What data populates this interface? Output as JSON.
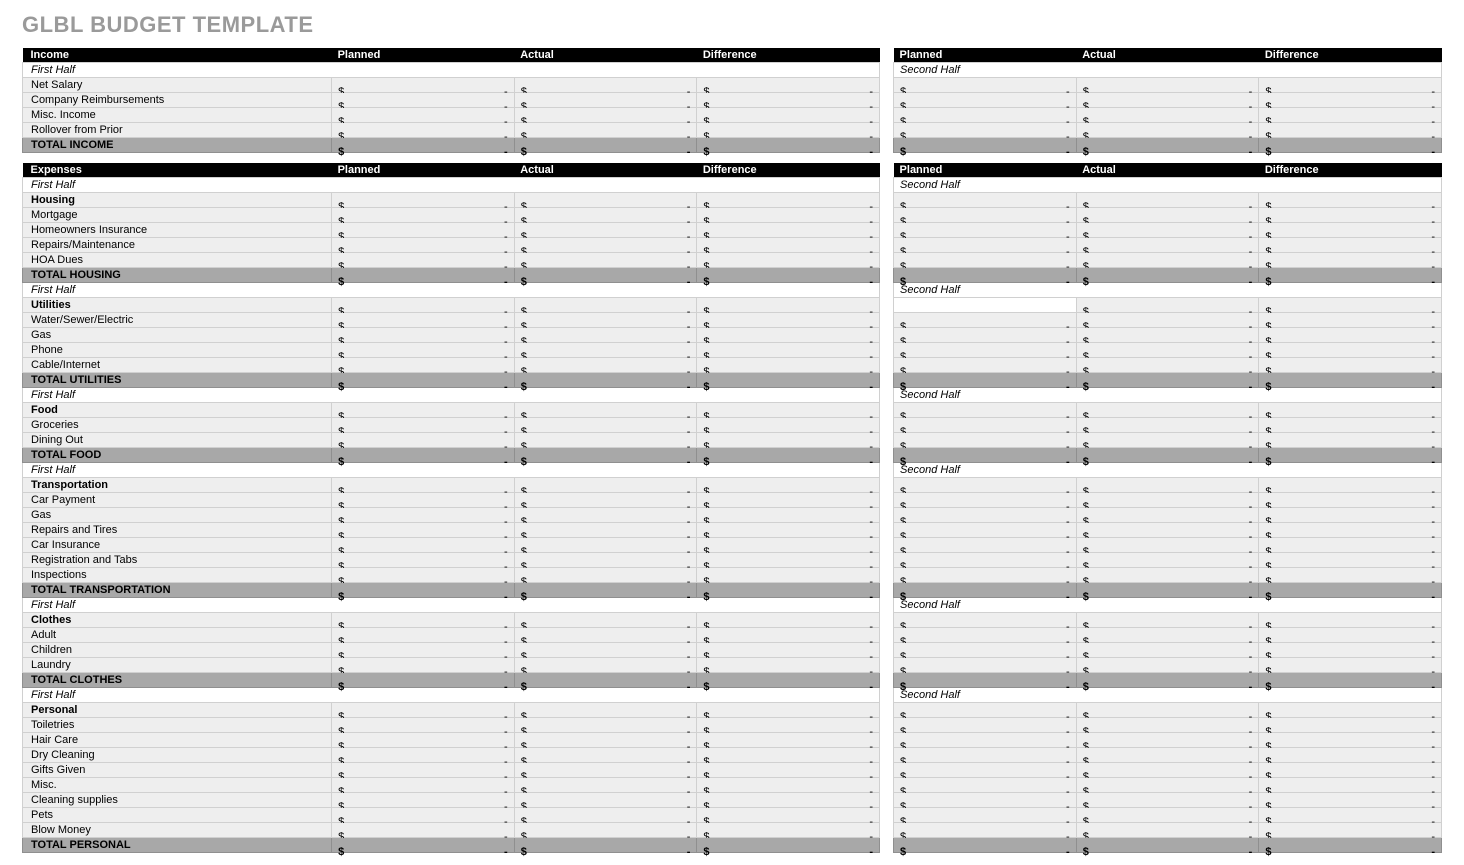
{
  "title": "GLBL BUDGET TEMPLATE",
  "headers": {
    "income": "Income",
    "expenses": "Expenses",
    "planned": "Planned",
    "actual": "Actual",
    "difference": "Difference"
  },
  "period": {
    "first": "First Half",
    "second": "Second Half"
  },
  "currency": "$",
  "dash": "-",
  "income": {
    "rows": [
      "Net Salary",
      "Company Reimbursements",
      "Misc. Income",
      "Rollover from Prior"
    ],
    "total": "TOTAL INCOME"
  },
  "expenses": [
    {
      "group": "Housing",
      "rows": [
        "Mortgage",
        "Homeowners Insurance",
        "Repairs/Maintenance",
        "HOA Dues"
      ],
      "total": "TOTAL HOUSING",
      "blankSecondHeader": false
    },
    {
      "group": "Utilities",
      "rows": [
        "Water/Sewer/Electric",
        "Gas",
        "Phone",
        "Cable/Internet"
      ],
      "total": "TOTAL UTILITIES",
      "blankSecondHeader": true
    },
    {
      "group": "Food",
      "rows": [
        "Groceries",
        "Dining Out"
      ],
      "total": "TOTAL FOOD",
      "blankSecondHeader": false
    },
    {
      "group": "Transportation",
      "rows": [
        "Car Payment",
        "Gas",
        "Repairs and Tires",
        "Car Insurance",
        "Registration and Tabs",
        "Inspections"
      ],
      "total": "TOTAL TRANSPORTATION",
      "blankSecondHeader": false
    },
    {
      "group": "Clothes",
      "rows": [
        "Adult",
        "Children",
        "Laundry"
      ],
      "total": "TOTAL CLOTHES",
      "blankSecondHeader": false
    },
    {
      "group": "Personal",
      "rows": [
        "Toiletries",
        "Hair Care",
        "Dry Cleaning",
        "Gifts Given",
        "Misc.",
        "Cleaning supplies",
        "Pets",
        "Blow Money"
      ],
      "total": "TOTAL PERSONAL",
      "blankSecondHeader": false
    }
  ]
}
